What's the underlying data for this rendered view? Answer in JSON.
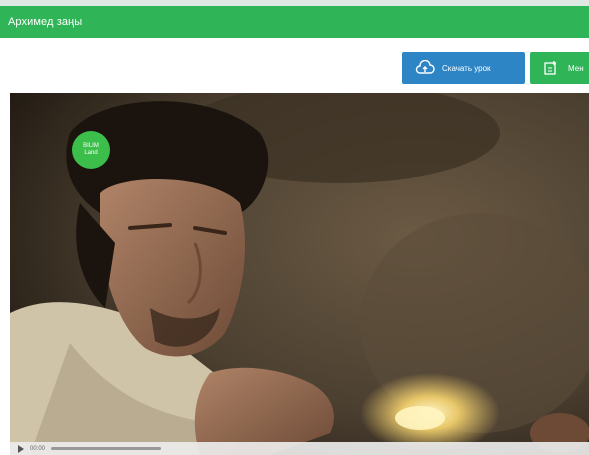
{
  "header": {
    "title": "Архимед заңы"
  },
  "toolbar": {
    "download_label": "Скачать урок",
    "extra_label": "Мен"
  },
  "video": {
    "badge_line1": "BILIM",
    "badge_line2": "Land",
    "time": "00:00",
    "progress": 0.0
  },
  "colors": {
    "header_green": "#2fb457",
    "download_blue": "#2d85c6",
    "badge_green": "#3bbf4a"
  },
  "icons": {
    "download": "cloud-upload-icon",
    "extra": "document-add-icon",
    "play": "play-icon"
  }
}
